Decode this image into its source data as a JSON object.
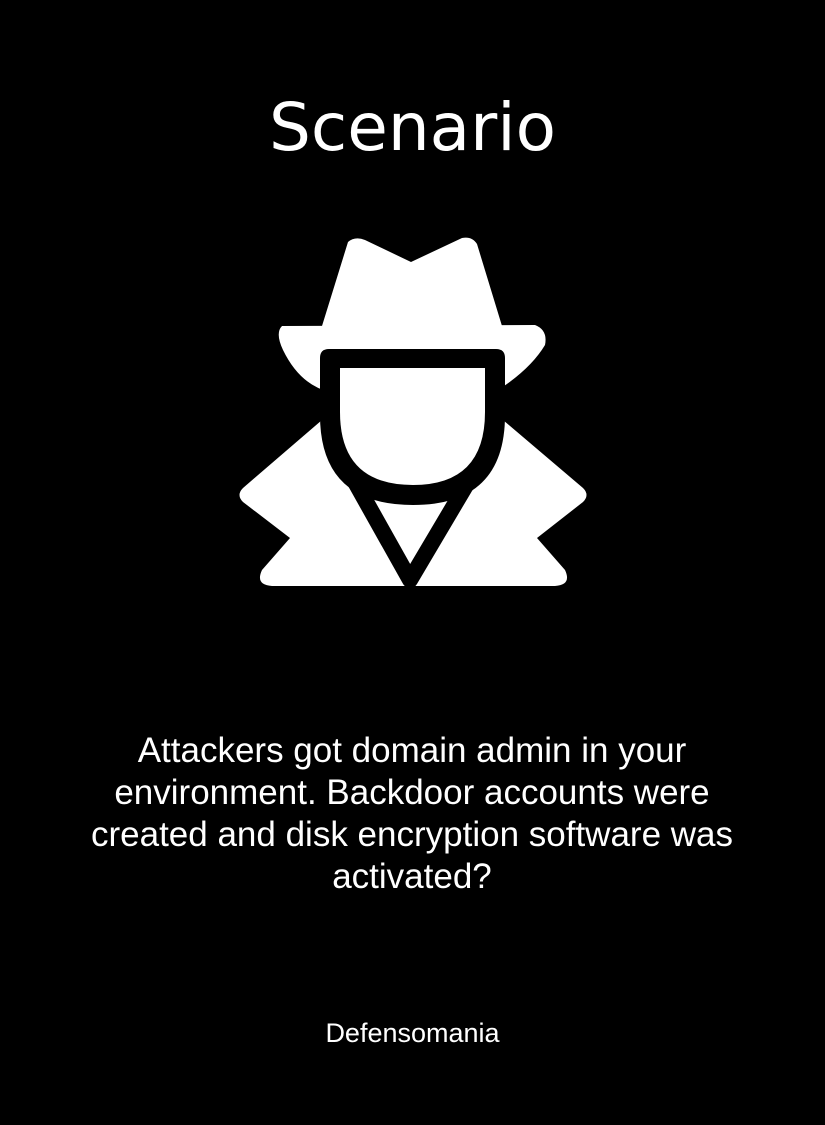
{
  "card": {
    "title": "Scenario",
    "icon": "spy-icon",
    "description": "Attackers got domain admin in your environment. Backdoor accounts were created and disk encryption software was activated?",
    "footer": "Defensomania"
  },
  "colors": {
    "background": "#000000",
    "foreground": "#ffffff"
  }
}
